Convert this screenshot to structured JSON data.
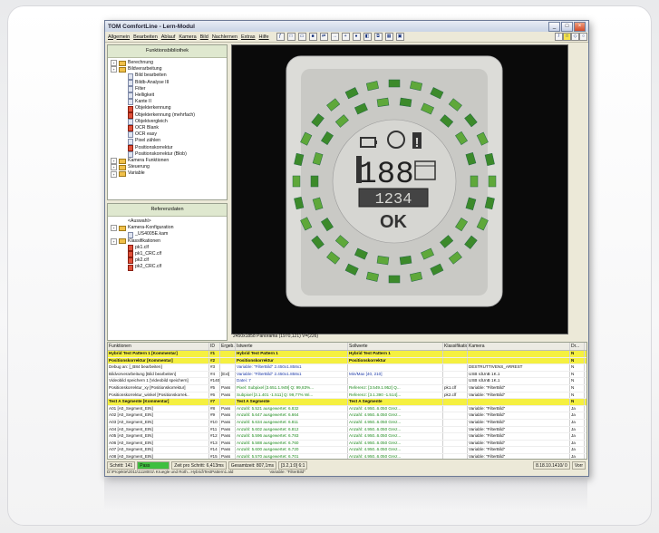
{
  "window": {
    "title": "TOM ComfortLine - Lern-Modul"
  },
  "menus": [
    "Allgemein",
    "Bearbeiten",
    "Ablauf",
    "Kamera",
    "Bild",
    "Nachlernen",
    "Extras",
    "Hilfe"
  ],
  "panel_functions": {
    "title": "Funktionsbibliothek",
    "items": [
      {
        "label": "Berechnung",
        "depth": 0,
        "kind": "folder"
      },
      {
        "label": "Bildverarbeitung",
        "depth": 0,
        "kind": "folder"
      },
      {
        "label": "Bild bearbeiten",
        "depth": 1,
        "kind": "doc"
      },
      {
        "label": "Bildb-Analyse III",
        "depth": 1,
        "kind": "doc"
      },
      {
        "label": "Filter",
        "depth": 1,
        "kind": "doc"
      },
      {
        "label": "Helligkeit",
        "depth": 1,
        "kind": "doc"
      },
      {
        "label": "Kante II",
        "depth": 1,
        "kind": "doc"
      },
      {
        "label": "Objekterkennung",
        "depth": 1,
        "kind": "red"
      },
      {
        "label": "Objekterkennung (mehrfach)",
        "depth": 1,
        "kind": "red"
      },
      {
        "label": "Objektvergleich",
        "depth": 1,
        "kind": "doc"
      },
      {
        "label": "OCR Blank",
        "depth": 1,
        "kind": "red"
      },
      {
        "label": "OCR easy",
        "depth": 1,
        "kind": "doc"
      },
      {
        "label": "Pixel zählen",
        "depth": 1,
        "kind": "doc"
      },
      {
        "label": "Positionskorrektur",
        "depth": 1,
        "kind": "red"
      },
      {
        "label": "Positionskorrektur (Blob)",
        "depth": 1,
        "kind": "doc"
      },
      {
        "label": "Kamera Funktionen",
        "depth": 0,
        "kind": "folder"
      },
      {
        "label": "Steuerung",
        "depth": 0,
        "kind": "folder"
      },
      {
        "label": "Variable",
        "depth": 0,
        "kind": "folder"
      }
    ]
  },
  "panel_refs": {
    "title": "Referenzdaten",
    "items": [
      {
        "label": "<Auswahl>",
        "depth": 1,
        "kind": "none"
      },
      {
        "label": "Kamera-Konfiguration",
        "depth": 0,
        "kind": "folder"
      },
      {
        "label": "_US4005E.kam",
        "depth": 1,
        "kind": "doc"
      },
      {
        "label": "Klassifikationen",
        "depth": 0,
        "kind": "folder"
      },
      {
        "label": "pk1.clf",
        "depth": 1,
        "kind": "red"
      },
      {
        "label": "pk1_CRC.clf",
        "depth": 1,
        "kind": "red"
      },
      {
        "label": "pk2.clf",
        "depth": 1,
        "kind": "red"
      },
      {
        "label": "pk2_CRC.clf",
        "depth": 1,
        "kind": "red"
      }
    ]
  },
  "image_status": "2450x1858 Panorama (1970,121) V=(226)",
  "display": {
    "digits": "188",
    "code": "1234",
    "ok": "OK"
  },
  "grid": {
    "headers": [
      "Funktionen",
      "ID",
      "Ergeb...",
      "Istwerte",
      "Sollwerte",
      "Klassifikatio",
      "Kamera",
      "Dr..."
    ],
    "rows": [
      {
        "y": true,
        "c": [
          "Hybrid Test Pattern 1  [Kommentar]",
          "#1",
          "",
          "Hybrid Test Pattern 1",
          "Hybrid Test Pattern 1",
          "",
          "",
          "N"
        ]
      },
      {
        "y": true,
        "c": [
          "Positionskorrektur  [Kommentar]",
          "#2",
          "",
          "Positionskorrektur",
          "Positionskorrektur",
          "",
          "",
          "N"
        ]
      },
      {
        "c": [
          "Debug an: [_B84 bearbeiten]",
          "#3",
          "",
          "Variable: \"FilterBild\" 2.450x1.858x1",
          "",
          "",
          "DESTRUTTIVENS_ARREST",
          "N"
        ]
      },
      {
        "c": [
          "Bildvorverarbeitung  [Bild bearbeiten]",
          "#4",
          "[Ext]",
          "Variable: \"FilterBild\" 2.450x1.858x1",
          "Min/Max [40, 210]",
          "",
          "USB rdUnB 1K.1",
          "N"
        ]
      },
      {
        "c": [
          "Videobild speichern 1 [Videobild speichern]",
          "#140",
          "",
          "Datei: 7",
          "",
          "",
          "USB rdUnB 1K.1",
          "N"
        ]
      },
      {
        "c": [
          "Positionskorrektur_xy  [Positionskorrektur]",
          "#5",
          "Pass",
          "Pixel: Subpixel [3.651.1.949] Q: 99,83%...",
          "Referenz: [3.549.1.952] Q...",
          "pk1.clf",
          "Variable: \"FilterBild\"",
          "N"
        ]
      },
      {
        "c": [
          "Positionskorrektur_winkel  [Positionskorrek..",
          "#6",
          "Pass",
          "Subpixel [3.1.401 -1.511] Q: 99,77% Wi...",
          "Referenz: [3.1.390 -1.514]...",
          "pk2.clf",
          "Variable: \"FilterBild\"",
          "N"
        ]
      },
      {
        "y": true,
        "c": [
          "Test A Segmente  [Kommentar]",
          "#7",
          "",
          "Test A Segmente",
          "Test A Segmente",
          "",
          "",
          "N"
        ]
      },
      {
        "c": [
          "A01  [A0_Segment_EIN]",
          "#8",
          "Pass",
          "Anzahl: 5.521 ausgewertet: 6.832",
          "Anzahl: 4.950..6.050  Grez...",
          "",
          "Variable: \"FilterBild\"",
          "Ja"
        ]
      },
      {
        "c": [
          "A02  [A0_Segment_EIN]",
          "#9",
          "Pass",
          "Anzahl: 5.647 ausgewertet: 6.664",
          "Anzahl: 4.950..6.050  Grez...",
          "",
          "Variable: \"FilterBild\"",
          "Ja"
        ]
      },
      {
        "c": [
          "A03  [A0_Segment_EIN]",
          "#10",
          "Pass",
          "Anzahl: 5.634 ausgewertet: 6.811",
          "Anzahl: 4.950..6.050  Grez...",
          "",
          "Variable: \"FilterBild\"",
          "Ja"
        ]
      },
      {
        "c": [
          "A04  [A0_Segment_EIN]",
          "#11",
          "Pass",
          "Anzahl: 5.602 ausgewertet: 6.812",
          "Anzahl: 4.950..6.050  Grez...",
          "",
          "Variable: \"FilterBild\"",
          "Ja"
        ]
      },
      {
        "c": [
          "A05  [A0_Segment_EIN]",
          "#12",
          "Pass",
          "Anzahl: 5.596 ausgewertet: 6.783",
          "Anzahl: 4.950..6.050  Grez...",
          "",
          "Variable: \"FilterBild\"",
          "Ja"
        ]
      },
      {
        "c": [
          "A06  [A0_Segment_EIN]",
          "#13",
          "Pass",
          "Anzahl: 5.588 ausgewertet: 6.760",
          "Anzahl: 4.950..6.050  Grez...",
          "",
          "Variable: \"FilterBild\"",
          "Ja"
        ]
      },
      {
        "c": [
          "A07  [A0_Segment_EIN]",
          "#14",
          "Pass",
          "Anzahl: 5.600 ausgewertet: 6.720",
          "Anzahl: 4.950..6.050  Grez...",
          "",
          "Variable: \"FilterBild\"",
          "Ja"
        ]
      },
      {
        "c": [
          "A08  [A0_Segment_EIN]",
          "#15",
          "Pass",
          "Anzahl: 5.570 ausgewertet: 6.701",
          "Anzahl: 4.950..6.050  Grez...",
          "",
          "Variable: \"FilterBild\"",
          "Ja"
        ]
      }
    ]
  },
  "status": {
    "step": "Schritt: 141",
    "result": "Pass",
    "time": "Zeit pro Schritt: 6,413ms",
    "total": "Gesamtzeit: 807,1ms",
    "coord": "[3.2,1:0] 6:1",
    "right": "8.18.10.1410/ 0",
    "mode": "Vorr"
  },
  "path": {
    "file": "D:\\Projekte\\2011\\1118001\\ Kruegle und Roth...Hybrid\\TestPattern1.ald",
    "variable": "Variable: \"FilterBild\""
  }
}
